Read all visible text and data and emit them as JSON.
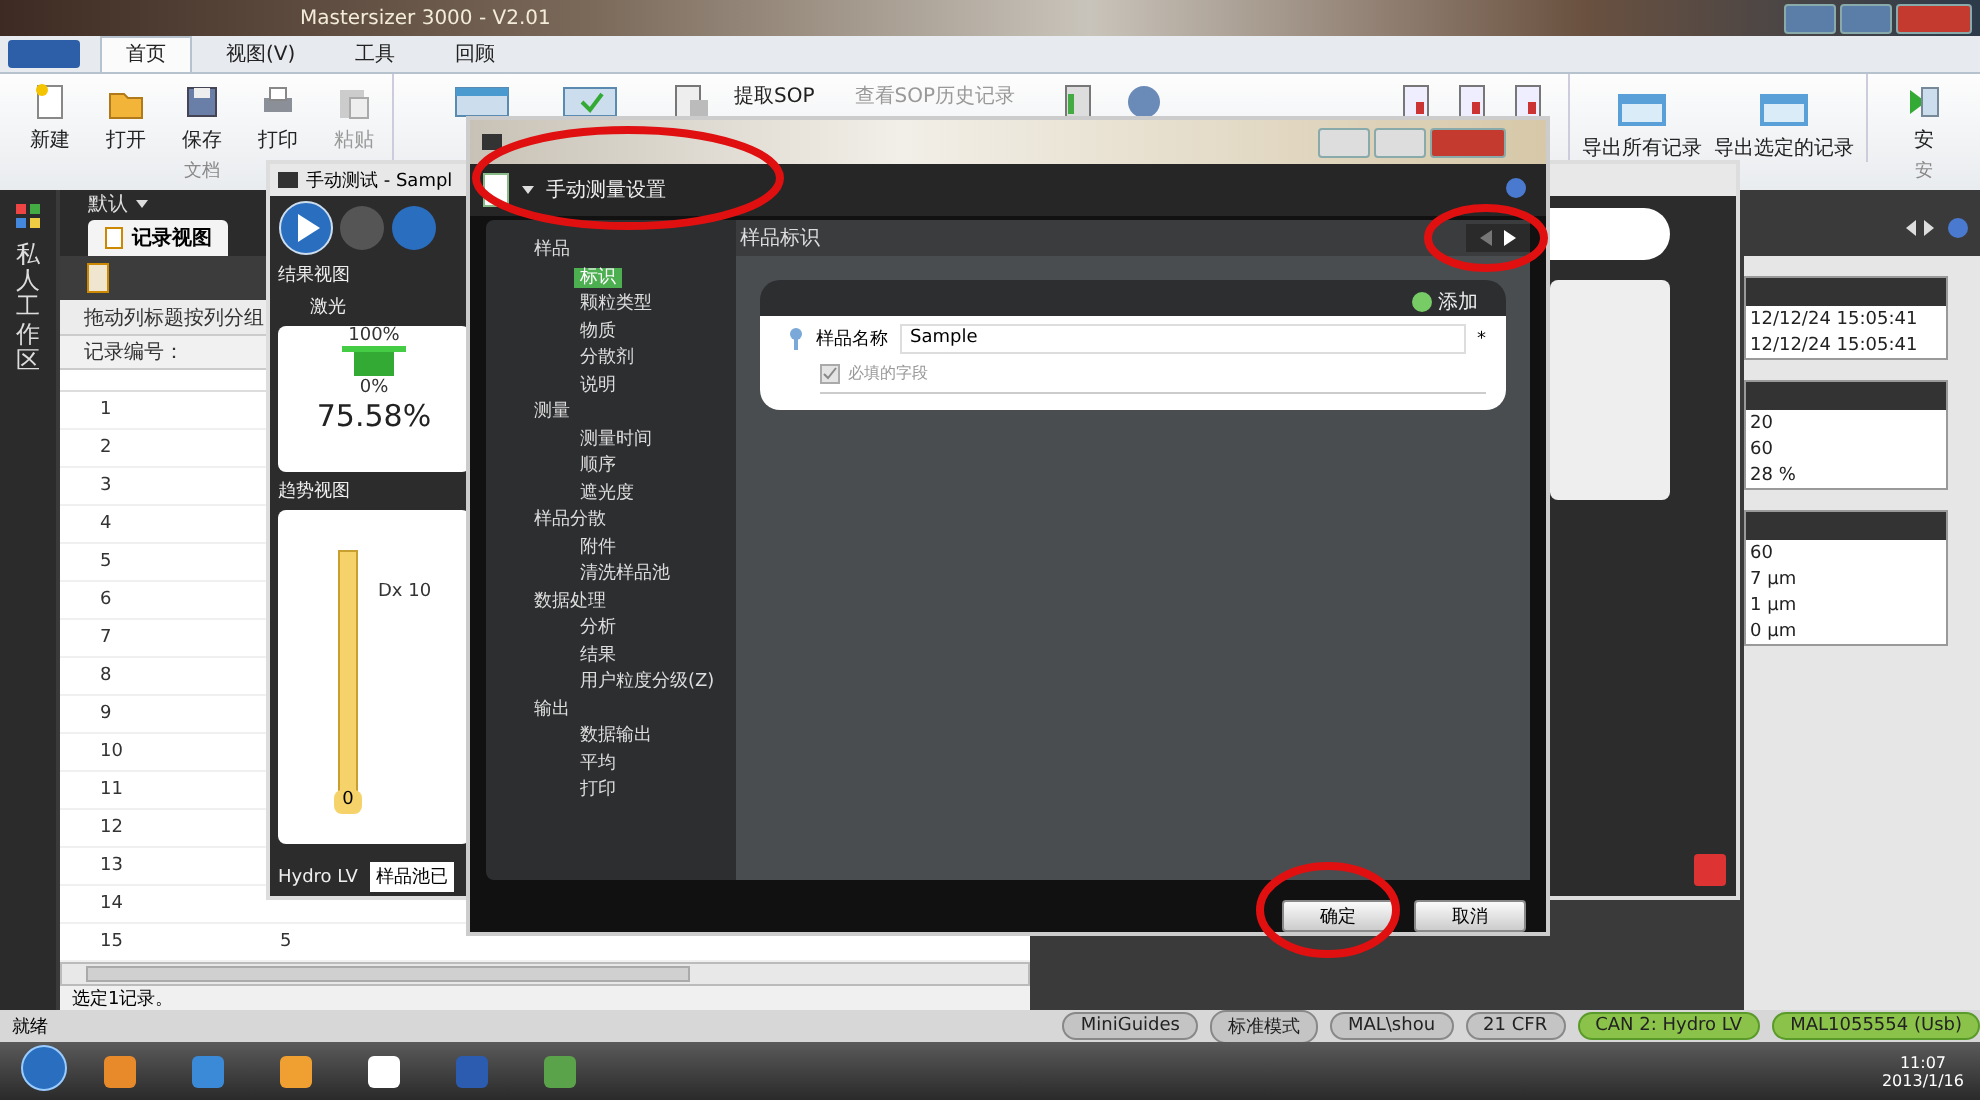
{
  "app": {
    "title": "Mastersizer 3000 - V2.01"
  },
  "ribbon": {
    "tabs": [
      {
        "label": "首页",
        "selected": true
      },
      {
        "label": "视图(V)",
        "selected": false
      },
      {
        "label": "工具",
        "selected": false
      },
      {
        "label": "回顾",
        "selected": false
      }
    ],
    "doc_buttons": [
      "新建",
      "打开",
      "保存",
      "打印",
      "粘贴"
    ],
    "doc_group": "文档",
    "sop_buttons": [
      "提取SOP",
      "查看SOP历史记录"
    ],
    "export_buttons": [
      "导出所有记录",
      "导出选定的记录"
    ],
    "last_button": "安",
    "last_group": "安"
  },
  "workspace": {
    "sidebar_label": "私人工作区",
    "view_menu": "默认",
    "tab": "记录视图",
    "group_hint": "拖动列标题按列分组",
    "column_1": "记录编号：",
    "rows": [
      {
        "column_1": "1"
      },
      {
        "column_1": "2"
      },
      {
        "column_1": "3"
      },
      {
        "column_1": "4"
      },
      {
        "column_1": "5"
      },
      {
        "column_1": "6"
      },
      {
        "column_1": "7"
      },
      {
        "column_1": "8"
      },
      {
        "column_1": "9"
      },
      {
        "column_1": "10"
      },
      {
        "column_1": "11"
      },
      {
        "column_1": "12"
      },
      {
        "column_1": "13"
      },
      {
        "column_1": "14"
      },
      {
        "column_1": "15",
        "column_2": "5"
      }
    ],
    "selection_status": "选定1记录。"
  },
  "right_panel": {
    "card_1": [
      "12/12/24 15:05:41",
      "12/12/24 15:05:41"
    ],
    "card_2": [
      "20",
      "60",
      "28 %"
    ],
    "card_3": [
      "60",
      "7 µm",
      "1 µm",
      "0 µm"
    ]
  },
  "measure_window": {
    "title": "手动测试 - Sampl",
    "results_label": "结果视图",
    "laser_label": "激光",
    "top_percent": "100%",
    "bottom_percent": "0%",
    "obscuration": "75.58%",
    "trend_label": "趋势视图",
    "trend_series": "Dx 10",
    "trend_value": "0",
    "accessory": "Hydro LV",
    "accessory_status": "样品池已"
  },
  "dialog": {
    "header": "手动测量设置",
    "tree": [
      {
        "label": "样品",
        "children": [
          {
            "label": "标识",
            "selected": true
          },
          {
            "label": "颗粒类型",
            "selected": false
          },
          {
            "label": "物质",
            "selected": false
          },
          {
            "label": "分散剂",
            "selected": false
          },
          {
            "label": "说明",
            "selected": false
          }
        ]
      },
      {
        "label": "测量",
        "children": [
          {
            "label": "测量时间",
            "selected": false
          },
          {
            "label": "顺序",
            "selected": false
          },
          {
            "label": "遮光度",
            "selected": false
          }
        ]
      },
      {
        "label": "样品分散",
        "children": [
          {
            "label": "附件",
            "selected": false
          },
          {
            "label": "清洗样品池",
            "selected": false
          }
        ]
      },
      {
        "label": "数据处理",
        "children": [
          {
            "label": "分析",
            "selected": false
          },
          {
            "label": "结果",
            "selected": false
          },
          {
            "label": "用户粒度分级(Z)",
            "selected": false
          }
        ]
      },
      {
        "label": "输出",
        "children": [
          {
            "label": "数据输出",
            "selected": false
          },
          {
            "label": "平均",
            "selected": false
          },
          {
            "label": "打印",
            "selected": false
          }
        ]
      }
    ],
    "section_title": "样品标识",
    "add_label": "添加",
    "field_label": "样品名称",
    "field_value": "Sample",
    "required_mark": "*",
    "required_checkbox": {
      "label": "必填的字段",
      "checked": true,
      "disabled": true
    },
    "buttons": [
      "确定",
      "取消"
    ]
  },
  "status_bar": {
    "left": "就绪",
    "items": [
      "MiniGuides",
      "标准模式",
      "MAL\\shou",
      "21 CFR",
      "CAN 2: Hydro LV",
      "MAL1055554 (Usb)"
    ]
  },
  "taskbar": {
    "time": "11:07",
    "date": "2013/1/16"
  }
}
